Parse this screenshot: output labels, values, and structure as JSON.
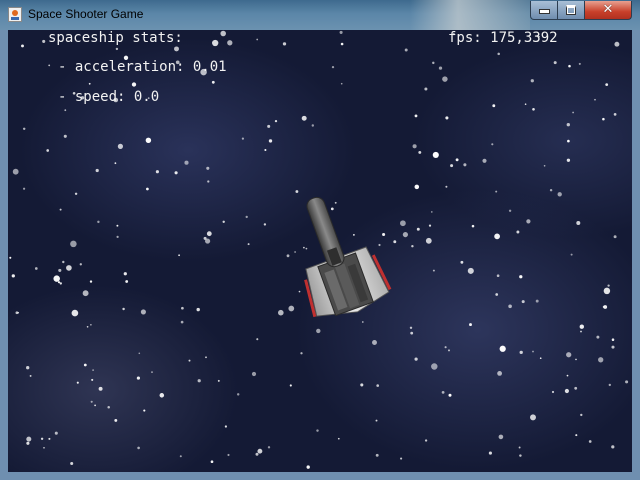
{
  "window": {
    "title": "Space Shooter Game",
    "controls": {
      "minimize": "minimize-icon",
      "maximize": "maximize-icon",
      "close": "close-icon"
    }
  },
  "hud": {
    "stats_label": "spaceship stats:",
    "acceleration_text": "- acceleration: 0.01",
    "speed_text": "- speed: 0.0",
    "fps_text": "fps: 175,3392"
  },
  "colors": {
    "space_background": "#141a35",
    "hud_text": "#f2f2f2",
    "titlebar": "#5b86a8",
    "close_button": "#c8402a"
  }
}
